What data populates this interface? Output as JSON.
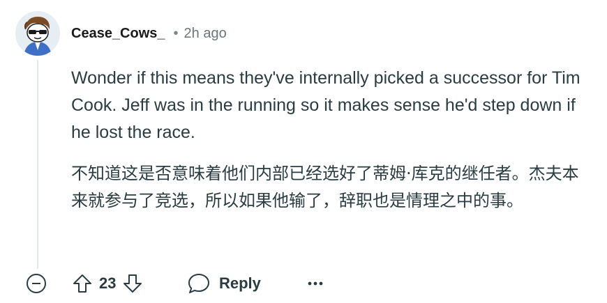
{
  "comment": {
    "author": "Cease_Cows_",
    "separator": "•",
    "time_ago": "2h ago",
    "paragraphs": [
      "Wonder if this means they've internally picked a successor for Tim Cook. Jeff was in the running so it makes sense he'd step down if he lost the race.",
      "不知道这是否意味着他们内部已经选好了蒂姆·库克的继任者。杰夫本来就参与了竞选，所以如果他输了，辞职也是情理之中的事。"
    ]
  },
  "actions": {
    "score": "23",
    "reply_label": "Reply",
    "more_label": "•••"
  },
  "icons": {
    "avatar": "avatar-icon",
    "collapse": "collapse-minus-icon",
    "upvote": "upvote-arrow-icon",
    "downvote": "downvote-arrow-icon",
    "reply": "speech-bubble-icon",
    "more": "ellipsis-icon"
  }
}
